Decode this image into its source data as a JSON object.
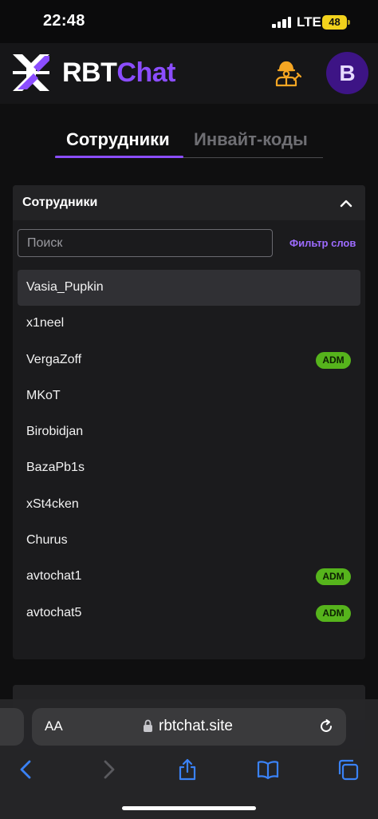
{
  "status_bar": {
    "time": "22:48",
    "network": "LTE",
    "battery": "48"
  },
  "header": {
    "logo_part1": "RBT",
    "logo_part2": "Chat",
    "avatar_letter": "B",
    "icons": [
      "logo-icon",
      "worker-icon"
    ]
  },
  "tabs": [
    {
      "label": "Сотрудники",
      "active": true
    },
    {
      "label": "Инвайт-коды",
      "active": false
    }
  ],
  "staff_panel": {
    "title": "Сотрудники",
    "search_placeholder": "Поиск",
    "filter_label": "Фильтр слов",
    "users": [
      {
        "name": "Vasia_Pupkin",
        "badge": "",
        "selected": true
      },
      {
        "name": "x1neel",
        "badge": ""
      },
      {
        "name": "VergaZoff",
        "badge": "ADM"
      },
      {
        "name": "MKoT",
        "badge": ""
      },
      {
        "name": "Birobidjan",
        "badge": ""
      },
      {
        "name": "BazaPb1s",
        "badge": ""
      },
      {
        "name": "xSt4cken",
        "badge": ""
      },
      {
        "name": "Churus",
        "badge": ""
      },
      {
        "name": "avtochat1",
        "badge": "ADM"
      },
      {
        "name": "avtochat5",
        "badge": "ADM"
      }
    ]
  },
  "browser": {
    "aa_label": "AA",
    "url": "rbtchat.site",
    "toolbar_icons": [
      "back-icon",
      "forward-icon",
      "share-icon",
      "bookmarks-icon",
      "tabs-icon"
    ]
  },
  "colors": {
    "accent": "#8b4dff",
    "badge": "#56b41c",
    "avatar_bg": "#3d1485",
    "icon_orange": "#f5a623",
    "ios_blue": "#3a82f7"
  }
}
